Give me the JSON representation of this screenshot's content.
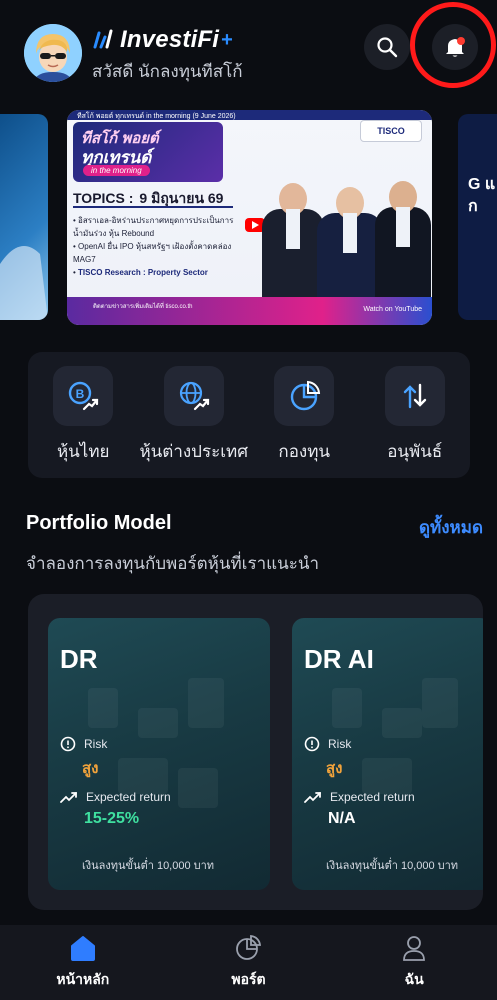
{
  "header": {
    "brand": "InvestiFi",
    "greeting": "สวัสดี นักลงทุนทีสโก้",
    "notification_dot_color": "#ff3b30",
    "highlight_ring_color": "#ff1a1a"
  },
  "banner": {
    "top_text": "ทีสโก้ พอยต์ ทุกเทรนด์ in the morning (9 June 2026)",
    "title_a": "ทีสโก้ พอยต์",
    "title_b": "ทุกเทรนด์",
    "tag": "in the morning",
    "topics_label": "TOPICS :",
    "topics_date": "9 มิถุนายน 69",
    "bullets": [
      "อิสราเอล-อิหร่านประกาศหยุดการประเป็นการ น้ำมันร่วง หุ้น Rebound",
      "OpenAI ยื่น IPO หุ้นสหรัฐฯ เฝ้องตั้งคาดคล่อง MAG7",
      "TISCO Research : Property Sector"
    ],
    "logo": "TISCO",
    "footer_text": "ติดตามข่าวสารเพิ่มเติมได้ที่ tisco.co.th",
    "watch_on": "Watch on YouTube",
    "peek_right_text": "G แ ก"
  },
  "quick_menu": [
    {
      "label": "หุ้นไทย",
      "icon": "thai-stock-icon"
    },
    {
      "label": "หุ้นต่างประเทศ",
      "icon": "global-stock-icon"
    },
    {
      "label": "กองทุน",
      "icon": "fund-pie-icon"
    },
    {
      "label": "อนุพันธ์",
      "icon": "derivatives-icon"
    }
  ],
  "portfolio": {
    "title": "Portfolio Model",
    "see_all": "ดูทั้งหมด",
    "subtitle": "จำลองการลงทุนกับพอร์ตหุ้นที่เราแนะนำ",
    "cards": [
      {
        "name": "DR",
        "risk_label": "Risk",
        "risk_value": "สูง",
        "return_label": "Expected return",
        "return_value": "15-25%",
        "return_color": "#3fe0a0",
        "min_invest": "เงินลงทุนขั้นต่ำ 10,000 บาท"
      },
      {
        "name": "DR AI",
        "risk_label": "Risk",
        "risk_value": "สูง",
        "return_label": "Expected return",
        "return_value": "N/A",
        "return_color": "#ffffff",
        "min_invest": "เงินลงทุนขั้นต่ำ 10,000 บาท"
      }
    ]
  },
  "bottom_nav": [
    {
      "label": "หน้าหลัก",
      "icon": "home-icon",
      "active": true
    },
    {
      "label": "พอร์ต",
      "icon": "portfolio-pie-icon",
      "active": false
    },
    {
      "label": "ฉัน",
      "icon": "user-icon",
      "active": false
    }
  ],
  "colors": {
    "background": "#0b0d12",
    "accent": "#3d8bff",
    "risk_high": "#f2a33b"
  }
}
